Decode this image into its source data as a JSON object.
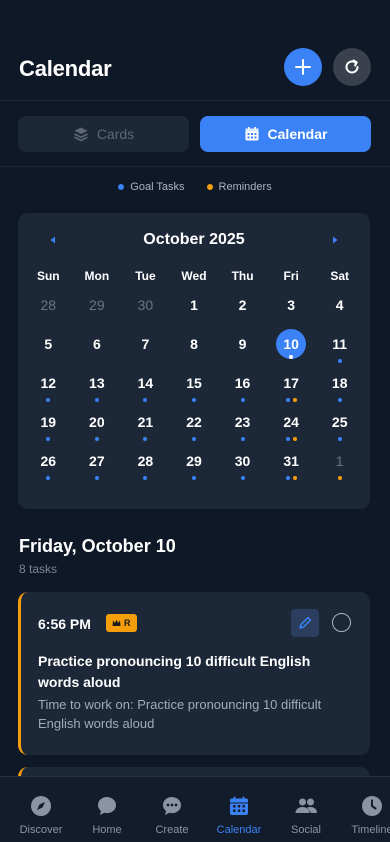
{
  "header": {
    "title": "Calendar"
  },
  "tabs": [
    {
      "label": "Cards",
      "active": false
    },
    {
      "label": "Calendar",
      "active": true
    }
  ],
  "legend": [
    {
      "label": "Goal Tasks",
      "color": "#3b82f6"
    },
    {
      "label": "Reminders",
      "color": "#f59e0b"
    }
  ],
  "calendar": {
    "month_label": "October 2025",
    "weekdays": [
      "Sun",
      "Mon",
      "Tue",
      "Wed",
      "Thu",
      "Fri",
      "Sat"
    ],
    "days": [
      {
        "n": "28",
        "muted": true,
        "dots": []
      },
      {
        "n": "29",
        "muted": true,
        "dots": []
      },
      {
        "n": "30",
        "muted": true,
        "dots": []
      },
      {
        "n": "1",
        "dots": []
      },
      {
        "n": "2",
        "dots": []
      },
      {
        "n": "3",
        "dots": []
      },
      {
        "n": "4",
        "dots": []
      },
      {
        "n": "5",
        "dots": []
      },
      {
        "n": "6",
        "dots": []
      },
      {
        "n": "7",
        "dots": []
      },
      {
        "n": "8",
        "dots": []
      },
      {
        "n": "9",
        "dots": []
      },
      {
        "n": "10",
        "selected": true,
        "dots": [
          "white"
        ]
      },
      {
        "n": "11",
        "dots": [
          "blue"
        ]
      },
      {
        "n": "12",
        "dots": [
          "blue"
        ]
      },
      {
        "n": "13",
        "dots": [
          "blue"
        ]
      },
      {
        "n": "14",
        "dots": [
          "blue"
        ]
      },
      {
        "n": "15",
        "dots": [
          "blue"
        ]
      },
      {
        "n": "16",
        "dots": [
          "blue"
        ]
      },
      {
        "n": "17",
        "dots": [
          "blue",
          "orange"
        ]
      },
      {
        "n": "18",
        "dots": [
          "blue"
        ]
      },
      {
        "n": "19",
        "dots": [
          "blue"
        ]
      },
      {
        "n": "20",
        "dots": [
          "blue"
        ]
      },
      {
        "n": "21",
        "dots": [
          "blue"
        ]
      },
      {
        "n": "22",
        "dots": [
          "blue"
        ]
      },
      {
        "n": "23",
        "dots": [
          "blue"
        ]
      },
      {
        "n": "24",
        "dots": [
          "blue",
          "orange"
        ]
      },
      {
        "n": "25",
        "dots": [
          "blue"
        ]
      },
      {
        "n": "26",
        "dots": [
          "blue"
        ]
      },
      {
        "n": "27",
        "dots": [
          "blue"
        ]
      },
      {
        "n": "28",
        "dots": [
          "blue"
        ]
      },
      {
        "n": "29",
        "dots": [
          "blue"
        ]
      },
      {
        "n": "30",
        "dots": [
          "blue"
        ]
      },
      {
        "n": "31",
        "dots": [
          "blue",
          "orange"
        ]
      },
      {
        "n": "1",
        "muted": true,
        "dots": [
          "orange"
        ]
      }
    ]
  },
  "selected_day": {
    "title": "Friday, October 10",
    "count": "8 tasks"
  },
  "task": {
    "time": "6:56 PM",
    "badge": "R",
    "title": "Practice pronouncing 10 difficult English words aloud",
    "description": "Time to work on: Practice pronouncing 10 difficult English words aloud"
  },
  "nav": [
    {
      "label": "Discover",
      "icon": "compass-icon",
      "active": false
    },
    {
      "label": "Home",
      "icon": "chat-bubble-icon",
      "active": false
    },
    {
      "label": "Create",
      "icon": "chat-dots-icon",
      "active": false
    },
    {
      "label": "Calendar",
      "icon": "calendar-icon",
      "active": true
    },
    {
      "label": "Social",
      "icon": "users-icon",
      "active": false
    },
    {
      "label": "Timeline",
      "icon": "clock-icon",
      "active": false
    }
  ],
  "colors": {
    "accent": "#3b82f6",
    "reminder": "#f59e0b",
    "background": "#0f1827",
    "card": "#1c2737"
  }
}
